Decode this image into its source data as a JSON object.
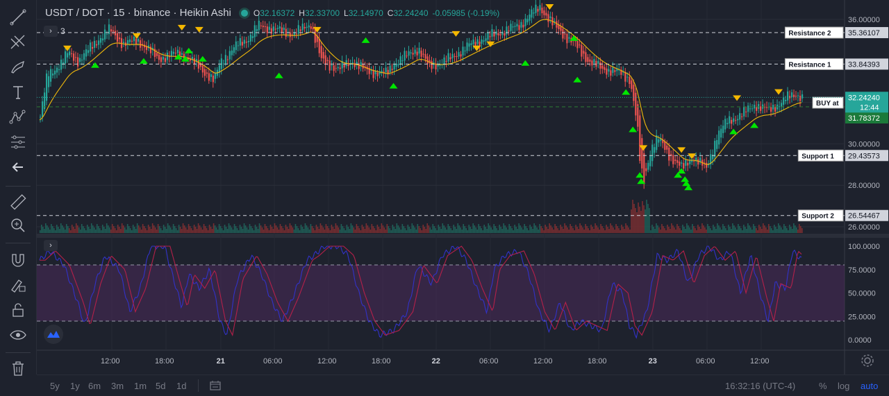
{
  "legend": {
    "symbol": "USDT / DOT · 15 · binance · Heikin Ashi",
    "o_label": "O",
    "o_value": "32.16372",
    "h_label": "H",
    "h_value": "32.33700",
    "l_label": "L",
    "l_value": "32.14970",
    "c_label": "C",
    "c_value": "32.24240",
    "change": "-0.05985 (-0.19%)",
    "indicator_count": "3"
  },
  "levels": [
    {
      "name": "Resistance 2",
      "price": "35.36107",
      "value": 35.36107
    },
    {
      "name": "Resistance 1",
      "price": "33.84393",
      "value": 33.84393
    },
    {
      "name": "Support 1",
      "price": "29.43573",
      "value": 29.43573
    },
    {
      "name": "Support 2",
      "price": "26.54467",
      "value": 26.54467
    }
  ],
  "buy": {
    "label": "BUY at",
    "price": "31.78372",
    "value": 31.78372
  },
  "current": {
    "price": "32.24240",
    "countdown": "12:44",
    "value": 32.2424
  },
  "price_axis": [
    {
      "label": "36.00000",
      "value": 36
    },
    {
      "label": "30.00000",
      "value": 30
    },
    {
      "label": "28.00000",
      "value": 28
    },
    {
      "label": "26.00000",
      "value": 26
    }
  ],
  "osc_axis": [
    {
      "label": "100.0000",
      "value": 100
    },
    {
      "label": "75.0000",
      "value": 75
    },
    {
      "label": "50.0000",
      "value": 50
    },
    {
      "label": "25.0000",
      "value": 25
    },
    {
      "label": "0.0000",
      "value": 0
    }
  ],
  "time_axis": [
    "12:00",
    "18:00",
    "21",
    "06:00",
    "12:00",
    "18:00",
    "22",
    "06:00",
    "12:00",
    "18:00",
    "23",
    "06:00",
    "12:00"
  ],
  "ranges": [
    "5y",
    "1y",
    "6m",
    "3m",
    "1m",
    "5d",
    "1d"
  ],
  "clock": "16:32:16 (UTC-4)",
  "scale_options": {
    "percent": "%",
    "log": "log",
    "auto": "auto"
  },
  "colors": {
    "up": "#26a69a",
    "down": "#ef5350",
    "ema": "#f0b90b",
    "arrow_up": "#00e600",
    "arrow_down": "#f5b800",
    "osc_k": "#3232c8",
    "osc_d": "#b4204a",
    "band": "#4a2a5a"
  },
  "icons": [
    "trend-line-icon",
    "fib-icon",
    "brush-icon",
    "text-icon",
    "pattern-icon",
    "measure-tree-icon",
    "back-arrow-icon",
    "ruler-icon",
    "zoom-icon",
    "magnet-icon",
    "lock-draw-icon",
    "unlock-icon",
    "eye-icon",
    "trash-icon"
  ],
  "chart_data": {
    "type": "candlestick",
    "price_range": [
      25.7,
      36.8
    ],
    "osc_range": [
      0,
      100
    ],
    "osc_bands": [
      20,
      80
    ],
    "anchors": [
      [
        0,
        31.3
      ],
      [
        10,
        33.3
      ],
      [
        30,
        33.9
      ],
      [
        40,
        34.4
      ],
      [
        55,
        34.0
      ],
      [
        85,
        35.1
      ],
      [
        100,
        35.5
      ],
      [
        120,
        34.8
      ],
      [
        140,
        35.0
      ],
      [
        170,
        34.1
      ],
      [
        200,
        34.4
      ],
      [
        230,
        33.7
      ],
      [
        250,
        33.0
      ],
      [
        260,
        34.0
      ],
      [
        285,
        34.8
      ],
      [
        300,
        35.1
      ],
      [
        315,
        35.7
      ],
      [
        340,
        35.5
      ],
      [
        365,
        35.3
      ],
      [
        390,
        35.8
      ],
      [
        405,
        34.0
      ],
      [
        430,
        33.6
      ],
      [
        450,
        34.0
      ],
      [
        470,
        33.5
      ],
      [
        500,
        33.4
      ],
      [
        510,
        33.9
      ],
      [
        525,
        34.2
      ],
      [
        545,
        34.6
      ],
      [
        560,
        33.7
      ],
      [
        590,
        34.1
      ],
      [
        615,
        34.7
      ],
      [
        640,
        35.1
      ],
      [
        665,
        35.4
      ],
      [
        690,
        35.7
      ],
      [
        705,
        36.2
      ],
      [
        720,
        36.6
      ],
      [
        740,
        35.7
      ],
      [
        770,
        34.8
      ],
      [
        790,
        34.0
      ],
      [
        810,
        33.6
      ],
      [
        830,
        33.5
      ],
      [
        850,
        33.1
      ],
      [
        860,
        31.0
      ],
      [
        865,
        28.8
      ],
      [
        870,
        28.2
      ],
      [
        880,
        29.8
      ],
      [
        890,
        30.3
      ],
      [
        905,
        29.5
      ],
      [
        925,
        28.8
      ],
      [
        940,
        29.4
      ],
      [
        960,
        28.8
      ],
      [
        975,
        30.4
      ],
      [
        990,
        31.1
      ],
      [
        1010,
        31.4
      ],
      [
        1030,
        31.9
      ],
      [
        1050,
        31.6
      ],
      [
        1075,
        32.2
      ],
      [
        1090,
        32.4
      ],
      [
        1099,
        32.24
      ]
    ],
    "arrows_up": [
      [
        80,
        34.2
      ],
      [
        150,
        34.4
      ],
      [
        200,
        34.6
      ],
      [
        210,
        34.5
      ],
      [
        215,
        34.9
      ],
      [
        235,
        34.5
      ],
      [
        345,
        33.7
      ],
      [
        470,
        35.4
      ],
      [
        510,
        33.2
      ],
      [
        700,
        34.3
      ],
      [
        770,
        35.5
      ],
      [
        775,
        33.5
      ],
      [
        845,
        32.9
      ],
      [
        855,
        31.1
      ],
      [
        865,
        28.9
      ],
      [
        867,
        28.6
      ],
      [
        920,
        28.9
      ],
      [
        925,
        29.1
      ],
      [
        930,
        28.7
      ],
      [
        932,
        28.5
      ],
      [
        935,
        28.3
      ],
      [
        1000,
        31.0
      ],
      [
        1030,
        31.3
      ]
    ],
    "arrows_down": [
      [
        40,
        34.2
      ],
      [
        140,
        34.8
      ],
      [
        205,
        35.2
      ],
      [
        230,
        35.1
      ],
      [
        400,
        35.1
      ],
      [
        600,
        34.9
      ],
      [
        630,
        34.2
      ],
      [
        650,
        34.4
      ],
      [
        735,
        36.2
      ],
      [
        870,
        29.4
      ],
      [
        925,
        29.3
      ],
      [
        940,
        29.0
      ],
      [
        1005,
        31.8
      ],
      [
        1065,
        32.1
      ]
    ],
    "osc_anchors": [
      [
        0,
        85
      ],
      [
        15,
        95
      ],
      [
        35,
        80
      ],
      [
        55,
        40
      ],
      [
        65,
        15
      ],
      [
        80,
        60
      ],
      [
        95,
        90
      ],
      [
        115,
        75
      ],
      [
        130,
        30
      ],
      [
        145,
        55
      ],
      [
        160,
        100
      ],
      [
        180,
        100
      ],
      [
        195,
        60
      ],
      [
        205,
        35
      ],
      [
        215,
        70
      ],
      [
        230,
        55
      ],
      [
        245,
        75
      ],
      [
        260,
        20
      ],
      [
        270,
        5
      ],
      [
        285,
        65
      ],
      [
        305,
        90
      ],
      [
        320,
        70
      ],
      [
        335,
        40
      ],
      [
        350,
        20
      ],
      [
        365,
        45
      ],
      [
        385,
        85
      ],
      [
        395,
        90
      ],
      [
        410,
        100
      ],
      [
        430,
        100
      ],
      [
        445,
        90
      ],
      [
        460,
        50
      ],
      [
        475,
        20
      ],
      [
        490,
        5
      ],
      [
        510,
        10
      ],
      [
        530,
        30
      ],
      [
        545,
        80
      ],
      [
        565,
        60
      ],
      [
        580,
        90
      ],
      [
        600,
        100
      ],
      [
        615,
        85
      ],
      [
        630,
        55
      ],
      [
        645,
        30
      ],
      [
        655,
        75
      ],
      [
        670,
        90
      ],
      [
        690,
        95
      ],
      [
        705,
        70
      ],
      [
        720,
        30
      ],
      [
        735,
        10
      ],
      [
        750,
        40
      ],
      [
        765,
        10
      ],
      [
        780,
        20
      ],
      [
        795,
        15
      ],
      [
        810,
        10
      ],
      [
        825,
        60
      ],
      [
        840,
        50
      ],
      [
        850,
        15
      ],
      [
        860,
        5
      ],
      [
        875,
        30
      ],
      [
        890,
        90
      ],
      [
        905,
        85
      ],
      [
        920,
        95
      ],
      [
        935,
        60
      ],
      [
        950,
        90
      ],
      [
        965,
        100
      ],
      [
        980,
        85
      ],
      [
        995,
        95
      ],
      [
        1010,
        50
      ],
      [
        1025,
        90
      ],
      [
        1040,
        45
      ],
      [
        1050,
        20
      ],
      [
        1060,
        60
      ],
      [
        1075,
        55
      ],
      [
        1085,
        95
      ],
      [
        1099,
        85
      ]
    ]
  }
}
